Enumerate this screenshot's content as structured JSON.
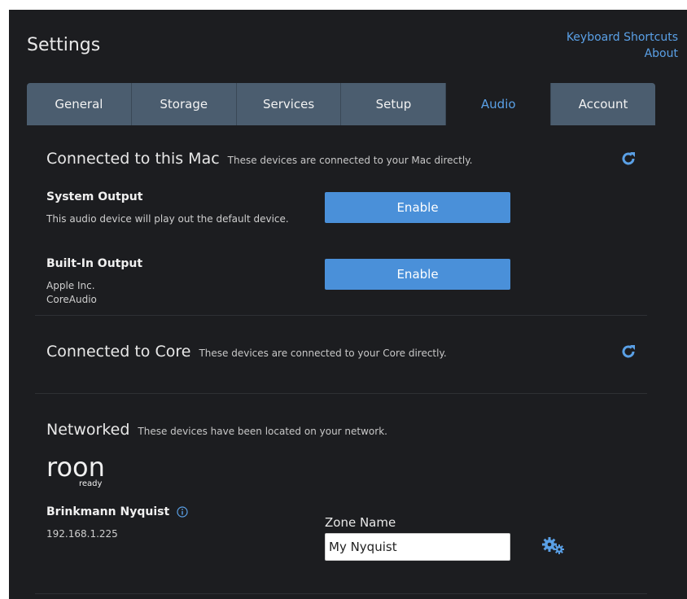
{
  "header": {
    "title": "Settings",
    "links": [
      "Keyboard Shortcuts",
      "About"
    ]
  },
  "tabs": [
    {
      "label": "General",
      "active": false
    },
    {
      "label": "Storage",
      "active": false
    },
    {
      "label": "Services",
      "active": false
    },
    {
      "label": "Setup",
      "active": false
    },
    {
      "label": "Audio",
      "active": true
    },
    {
      "label": "Account",
      "active": false
    }
  ],
  "sections": {
    "mac": {
      "title": "Connected to this Mac",
      "subtitle": "These devices are connected to your Mac directly.",
      "devices": [
        {
          "name": "System Output",
          "lines": [
            "This audio device will play out the default device."
          ],
          "button": "Enable"
        },
        {
          "name": "Built-In Output",
          "lines": [
            "Apple Inc.",
            "CoreAudio"
          ],
          "button": "Enable"
        }
      ]
    },
    "core": {
      "title": "Connected to Core",
      "subtitle": "These devices are connected to your Core directly."
    },
    "networked": {
      "title": "Networked",
      "subtitle": "These devices have been located on your network.",
      "logo_text": "roon",
      "logo_sub": "ready",
      "device": {
        "name": "Brinkmann Nyquist",
        "ip": "192.168.1.225",
        "zone_label": "Zone Name",
        "zone_value": "My Nyquist"
      }
    }
  },
  "colors": {
    "accent": "#5aa0e6",
    "button": "#4a90d9",
    "tab_bar": "#4b5d6f",
    "background": "#1c1d20"
  },
  "icons": [
    "refresh-icon",
    "info-icon",
    "gear-icon"
  ]
}
